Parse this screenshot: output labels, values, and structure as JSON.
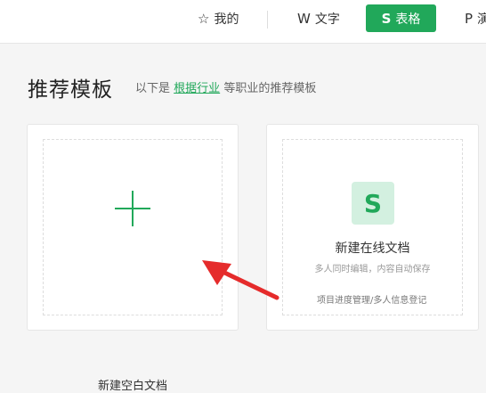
{
  "topnav": {
    "items": [
      {
        "icon": "star-icon",
        "label": "我的"
      },
      {
        "icon": "w-doc-icon",
        "label": "文字"
      },
      {
        "icon": "s-sheet-icon",
        "label": "表格"
      },
      {
        "icon": "p-slide-icon",
        "label": "演"
      }
    ],
    "active_color": "#21a85a"
  },
  "heading": {
    "title": "推荐模板",
    "subtitle_prefix": "以下是",
    "subtitle_link": "根据行业",
    "subtitle_suffix": "等职业的推荐模板"
  },
  "cards": {
    "blank": {
      "label": "新建空白文档"
    },
    "online": {
      "title": "新建在线文档",
      "desc": "多人同时编辑，内容自动保存",
      "footer": "项目进度管理/多人信息登记"
    }
  },
  "annotation": {
    "arrow_color": "#e52b2b"
  }
}
